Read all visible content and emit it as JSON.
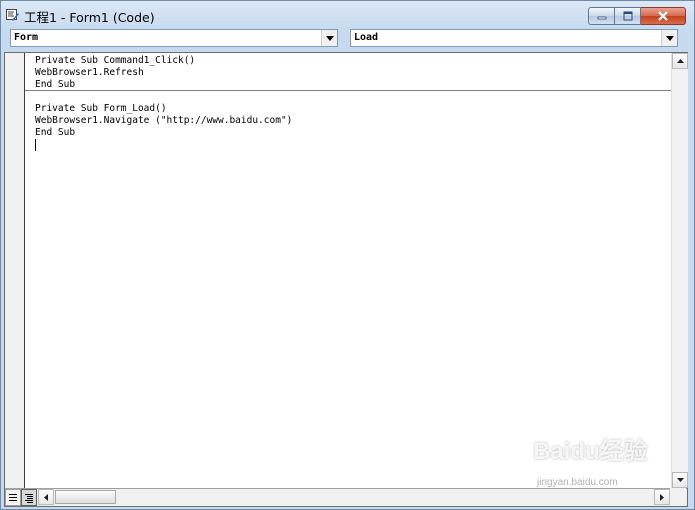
{
  "window": {
    "title": "工程1 - Form1 (Code)",
    "icon": "code-window-icon"
  },
  "caption_buttons": {
    "minimize": "minimize-icon",
    "maximize": "maximize-icon",
    "close": "close-icon"
  },
  "object_combo": {
    "selected": "Form"
  },
  "procedure_combo": {
    "selected": "Load"
  },
  "code": {
    "procedures": [
      {
        "lines": [
          "Private Sub Command1_Click()",
          "WebBrowser1.Refresh",
          "End Sub"
        ]
      },
      {
        "lines": [
          "Private Sub Form_Load()",
          "WebBrowser1.Navigate (\"http://www.baidu.com\")",
          "End Sub"
        ]
      }
    ]
  },
  "view_buttons": {
    "procedure_view": "procedure-view-icon",
    "full_module_view": "full-module-view-icon"
  },
  "watermark": {
    "brand": "Baidu经验",
    "sub": "jingyan.baidu.com"
  },
  "colors": {
    "titlebar": "#c6d9ee",
    "close_button": "#c2401f",
    "editor_background": "#ffffff"
  }
}
